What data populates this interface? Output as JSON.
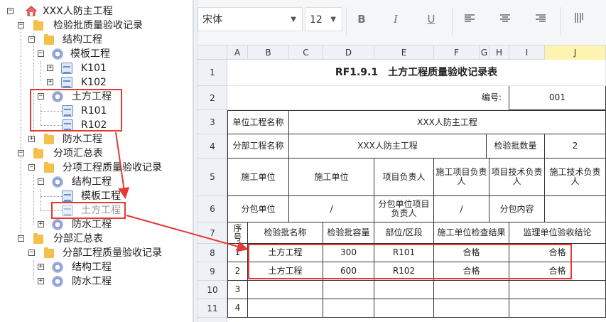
{
  "tree": {
    "root": "XXX人防主工程",
    "n1": "检验批质量验收记录",
    "n2": "结构工程",
    "n3": "模板工程",
    "n4": "K101",
    "n5": "K102",
    "n6": "土方工程",
    "n7": "R101",
    "n8": "R102",
    "n9": "防水工程",
    "n10": "分项汇总表",
    "n11": "分项工程质量验收记录",
    "n12": "结构工程",
    "n13": "模板工程",
    "n14": "土方工程",
    "n15": "防水工程",
    "n16": "分部汇总表",
    "n17": "分部工程质量验收记录",
    "n18": "结构工程",
    "n19": "防水工程"
  },
  "toolbar": {
    "font": "宋体",
    "size": "12",
    "bold": "B",
    "italic": "I",
    "underline": "U"
  },
  "sheet": {
    "cols": [
      "A",
      "B",
      "C",
      "D",
      "E",
      "F",
      "G",
      "H",
      "I",
      "J"
    ],
    "rows": [
      "1",
      "2",
      "3",
      "4",
      "5",
      "6",
      "7",
      "8",
      "9",
      "10",
      "11"
    ],
    "title": "RF1.9.1　土方工程质量验收记录表",
    "code_label": "编号:",
    "code_value": "001",
    "unit_name_label": "单位工程名称",
    "unit_name_value": "XXX人防主工程",
    "part_name_label": "分部工程名称",
    "part_name_value": "XXX人防主工程",
    "batch_count_label": "检验批数量",
    "batch_count_value": "2",
    "r5_a": "施工单位",
    "r5_b": "施工单位",
    "r5_c": "项目负责人",
    "r5_d": "施工项目负责人",
    "r5_e": "项目技术负责人",
    "r5_f": "施工技术负责人",
    "r6_a": "分包单位",
    "r6_b": "/",
    "r6_c": "分包单位项目负责人",
    "r6_d": "/",
    "r6_e": "分包内容",
    "h_no": "序号",
    "h_name": "检验批名称",
    "h_cap": "检验批容量",
    "h_area": "部位/区段",
    "h_check": "施工单位检查结果",
    "h_accept": "监理单位验收结论",
    "rows_data": [
      {
        "no": "1",
        "name": "土方工程",
        "cap": "300",
        "area": "R101",
        "check": "合格",
        "accept": "合格"
      },
      {
        "no": "2",
        "name": "土方工程",
        "cap": "600",
        "area": "R102",
        "check": "合格",
        "accept": "合格"
      },
      {
        "no": "3",
        "name": "",
        "cap": "",
        "area": "",
        "check": "",
        "accept": ""
      },
      {
        "no": "4",
        "name": "",
        "cap": "",
        "area": "",
        "check": "",
        "accept": ""
      }
    ]
  }
}
